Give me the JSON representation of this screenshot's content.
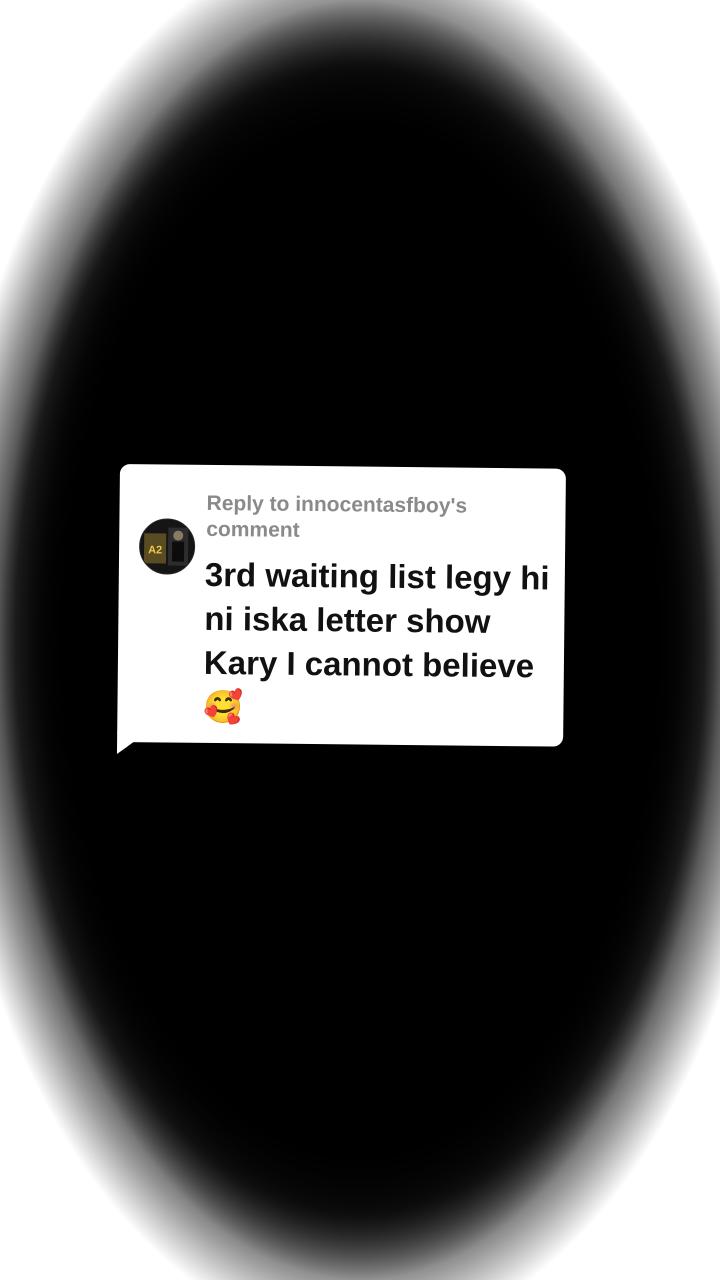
{
  "reply": {
    "header": "Reply to innocentasfboy's comment",
    "text": "3rd waiting list legy hi ni iska letter show Kary I cannot believe",
    "emoji": "🥰"
  },
  "avatar": {
    "label": "A2"
  },
  "colors": {
    "bubble": "#ffffff",
    "header_text": "#8a8a8a",
    "comment_text": "#111111",
    "background": "#000000"
  }
}
